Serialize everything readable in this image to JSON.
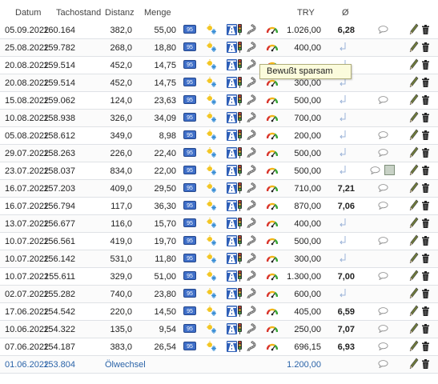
{
  "columns": {
    "datum": "Datum",
    "tachostand": "Tachostand",
    "distanz": "Distanz",
    "menge": "Menge",
    "try": "TRY",
    "avg": "Ø"
  },
  "icons": {
    "fuel_badge": "95",
    "season": "sun-snow-icon",
    "road": "highway-icon",
    "traffic": "traffic-light-icon",
    "curve": "winding-road-icon",
    "gauge": "economy-gauge-icon",
    "note": "comment-bubble-icon",
    "edit": "pencil-icon",
    "delete": "trash-icon"
  },
  "tooltip": "Bewußt sparsam",
  "colors": {
    "link": "#2a63a8",
    "fuel_badge": "#3f6fc8",
    "gauge_green": "#3aa635",
    "gauge_red": "#d9342b"
  },
  "rows": [
    {
      "datum": "05.09.2022",
      "tacho": "160.164",
      "dist": "382,0",
      "menge": "55,00",
      "try": "1.026,00",
      "avg": "6,28",
      "ret": false,
      "bubble": true
    },
    {
      "datum": "25.08.2022",
      "tacho": "159.782",
      "dist": "268,0",
      "menge": "18,80",
      "try": "400,00",
      "avg": "",
      "ret": true,
      "bubble": false
    },
    {
      "datum": "20.08.2022",
      "tacho": "159.514",
      "dist": "452,0",
      "menge": "14,75",
      "try": "",
      "avg": "",
      "ret": true,
      "bubble": false
    },
    {
      "datum": "20.08.2022",
      "tacho": "159.514",
      "dist": "452,0",
      "menge": "14,75",
      "try": "300,00",
      "avg": "",
      "ret": true,
      "bubble": false
    },
    {
      "datum": "15.08.2022",
      "tacho": "159.062",
      "dist": "124,0",
      "menge": "23,63",
      "try": "500,00",
      "avg": "",
      "ret": true,
      "bubble": true
    },
    {
      "datum": "10.08.2022",
      "tacho": "158.938",
      "dist": "326,0",
      "menge": "34,09",
      "try": "700,00",
      "avg": "",
      "ret": true,
      "bubble": false
    },
    {
      "datum": "05.08.2022",
      "tacho": "158.612",
      "dist": "349,0",
      "menge": "8,98",
      "try": "200,00",
      "avg": "",
      "ret": true,
      "bubble": true
    },
    {
      "datum": "29.07.2022",
      "tacho": "158.263",
      "tacho2": "",
      "dist": "226,0",
      "menge": "22,40",
      "try": "500,00",
      "avg": "",
      "ret": true,
      "bubble": true
    },
    {
      "datum": "23.07.2022",
      "tacho": "158.037",
      "dist": "834,0",
      "menge": "22,00",
      "try": "500,00",
      "avg": "",
      "ret": true,
      "bubble": true,
      "photo": true
    },
    {
      "datum": "16.07.2022",
      "tacho": "157.203",
      "dist": "409,0",
      "menge": "29,50",
      "try": "710,00",
      "avg": "7,21",
      "ret": false,
      "bubble": true
    },
    {
      "datum": "16.07.2022",
      "tacho": "156.794",
      "dist": "117,0",
      "menge": "36,30",
      "try": "870,00",
      "avg": "7,06",
      "ret": false,
      "bubble": true
    },
    {
      "datum": "13.07.2022",
      "tacho": "156.677",
      "dist": "116,0",
      "menge": "15,70",
      "try": "400,00",
      "avg": "",
      "ret": true,
      "bubble": false
    },
    {
      "datum": "10.07.2022",
      "tacho": "156.561",
      "dist": "419,0",
      "menge": "19,70",
      "try": "500,00",
      "avg": "",
      "ret": true,
      "bubble": true
    },
    {
      "datum": "10.07.2022",
      "tacho": "156.142",
      "dist": "531,0",
      "menge": "11,80",
      "try": "300,00",
      "avg": "",
      "ret": true,
      "bubble": false
    },
    {
      "datum": "10.07.2022",
      "tacho": "155.611",
      "dist": "329,0",
      "menge": "51,00",
      "try": "1.300,00",
      "avg": "7,00",
      "ret": false,
      "bubble": true
    },
    {
      "datum": "02.07.2022",
      "tacho": "155.282",
      "dist": "740,0",
      "menge": "23,80",
      "try": "600,00",
      "avg": "",
      "ret": true,
      "bubble": false
    },
    {
      "datum": "17.06.2022",
      "tacho": "154.542",
      "dist": "220,0",
      "menge": "14,50",
      "try": "405,00",
      "avg": "6,59",
      "ret": false,
      "bubble": true
    },
    {
      "datum": "10.06.2022",
      "tacho": "154.322",
      "dist": "135,0",
      "menge": "9,54",
      "try": "250,00",
      "avg": "7,07",
      "ret": false,
      "bubble": true
    },
    {
      "datum": "07.06.2022",
      "tacho": "154.187",
      "dist": "383,0",
      "menge": "26,54",
      "try": "696,15",
      "avg": "6,93",
      "ret": false,
      "bubble": true
    },
    {
      "datum": "01.06.2022",
      "tacho": "153.804",
      "note": "Ölwechsel",
      "try": "1.200,00",
      "link": true,
      "bubble": true
    }
  ]
}
